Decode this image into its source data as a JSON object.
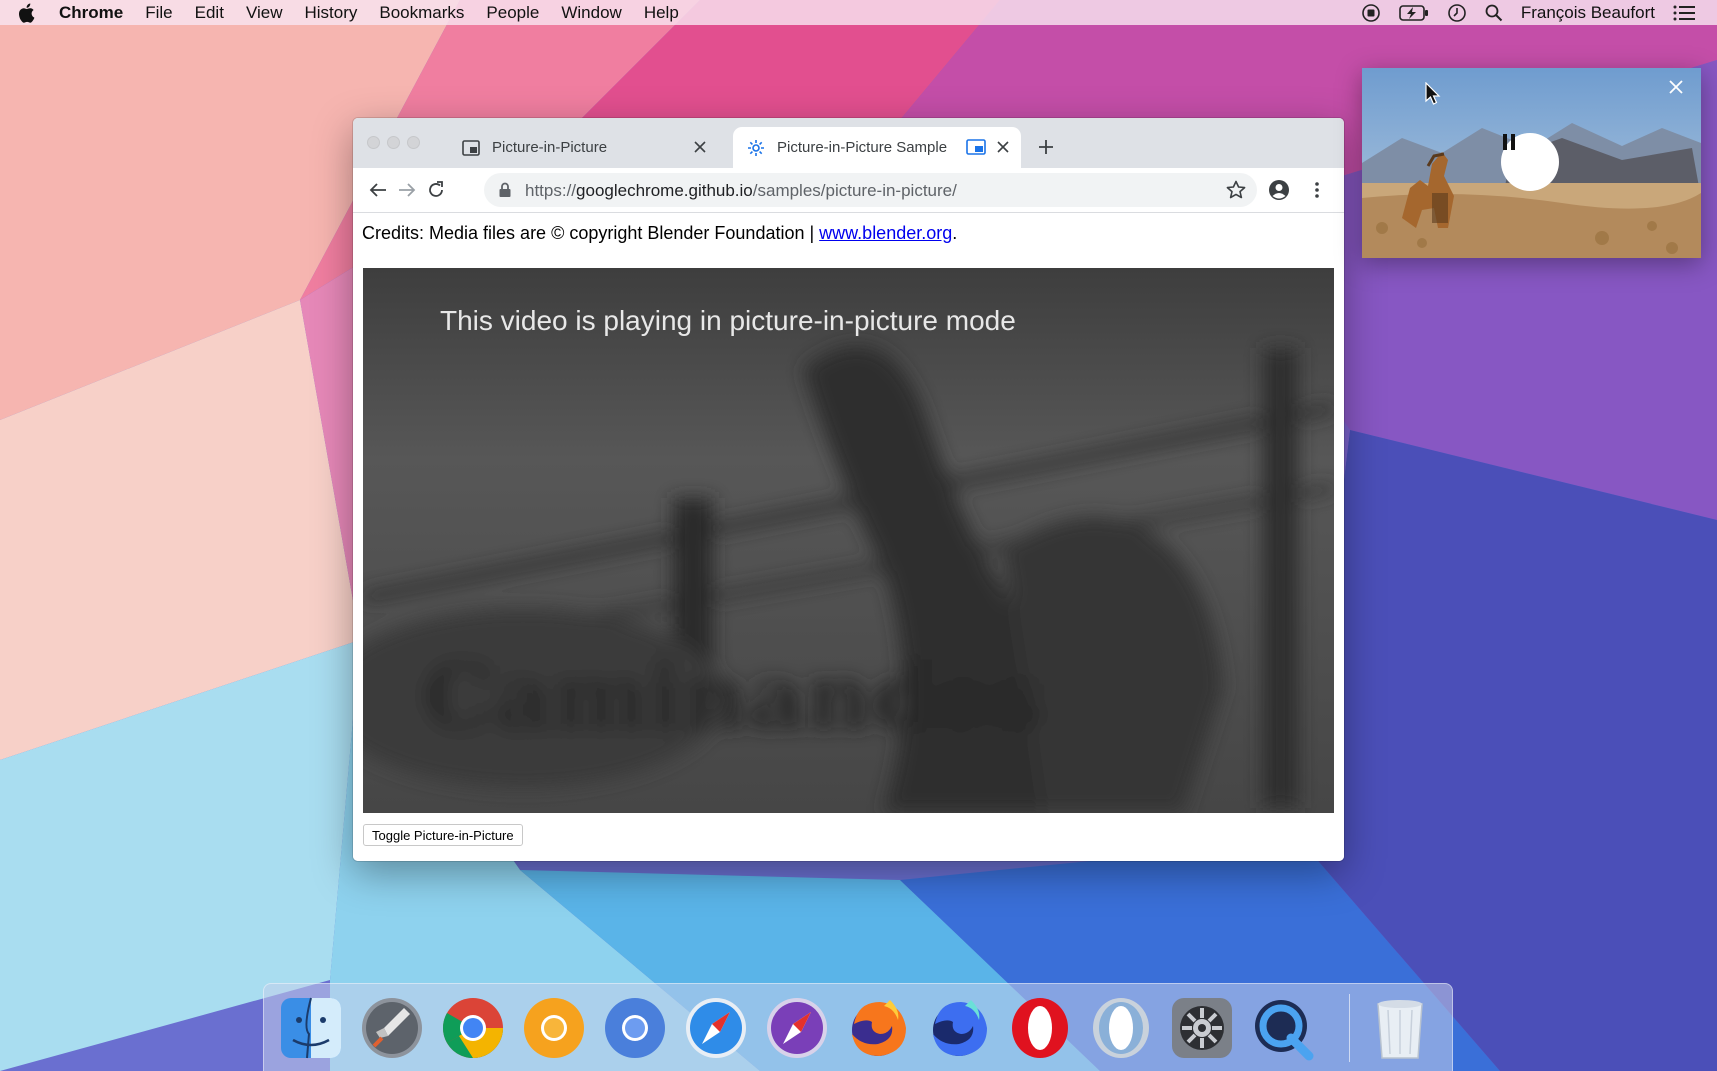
{
  "menubar": {
    "app_name": "Chrome",
    "items": [
      "File",
      "Edit",
      "View",
      "History",
      "Bookmarks",
      "People",
      "Window",
      "Help"
    ],
    "user_name": "François Beaufort"
  },
  "browser": {
    "tabs": [
      {
        "title": "Picture-in-Picture",
        "active": false
      },
      {
        "title": "Picture-in-Picture Sample",
        "active": true
      }
    ],
    "url": {
      "scheme": "https://",
      "host": "googlechrome.github.io",
      "path": "/samples/picture-in-picture/"
    },
    "page": {
      "credits_text": "Credits: Media files are © copyright Blender Foundation | ",
      "credits_link": "www.blender.org",
      "credits_end": ".",
      "video_message": "This video is playing in picture-in-picture mode",
      "toggle_button": "Toggle Picture-in-Picture"
    }
  },
  "pip": {
    "control_icon": "pause-icon",
    "close_icon": "close-icon"
  },
  "dock": {
    "items": [
      "Finder",
      "Launchpad",
      "Google Chrome",
      "Chrome Canary",
      "Chromium",
      "Safari",
      "Safari Technology Preview",
      "Firefox",
      "Firefox Nightly",
      "Opera",
      "Opera Developer",
      "System Preferences",
      "QuickTime Player",
      "Trash"
    ]
  },
  "colors": {
    "link": "#0000ee",
    "tabstrip": "#dee1e6",
    "omnibox": "#f1f3f4",
    "active_tab_favicon": "#1a73e8"
  }
}
